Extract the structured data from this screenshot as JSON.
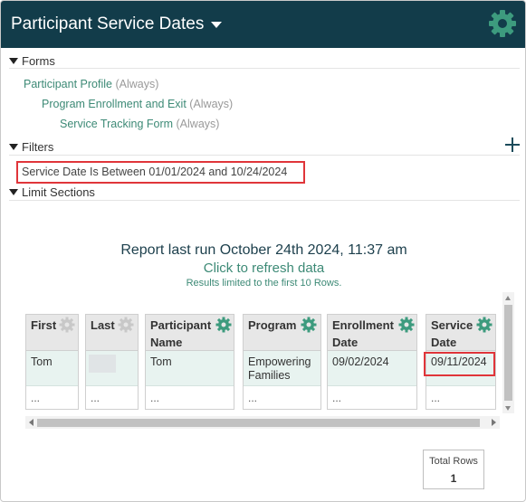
{
  "header": {
    "title": "Participant Service Dates",
    "gear_icon": "gear-icon",
    "brand_color": "#123c4a",
    "accent_color": "#3d8a76"
  },
  "forms": {
    "heading": "Forms",
    "items": [
      {
        "name": "Participant Profile",
        "mode": "(Always)"
      },
      {
        "name": "Program Enrollment and Exit",
        "mode": "(Always)"
      },
      {
        "name": "Service Tracking Form",
        "mode": "(Always)"
      }
    ]
  },
  "filters": {
    "heading": "Filters",
    "add_icon": "plus-icon",
    "items": [
      "Service Date Is Between 01/01/2024 and 10/24/2024"
    ]
  },
  "limit_sections": {
    "heading": "Limit Sections"
  },
  "report": {
    "last_run": "Report last run October 24th 2024, 11:37 am",
    "refresh": "Click to refresh data",
    "limit_note": "Results limited to the first 10 Rows."
  },
  "table": {
    "columns": [
      {
        "line1": "First",
        "line2": ""
      },
      {
        "line1": "Last",
        "line2": ""
      },
      {
        "line1": "Participant",
        "line2": "Name"
      },
      {
        "line1": "Program",
        "line2": ""
      },
      {
        "line1": "Enrollment",
        "line2": "Date"
      },
      {
        "line1": "Service",
        "line2": "Date"
      }
    ],
    "rows": [
      [
        "Tom",
        "",
        "Tom",
        "Empowering Families",
        "09/02/2024",
        "09/11/2024"
      ],
      [
        "...",
        "...",
        "...",
        "...",
        "...",
        "..."
      ]
    ]
  },
  "totals": {
    "label": "Total Rows",
    "value": "1"
  }
}
